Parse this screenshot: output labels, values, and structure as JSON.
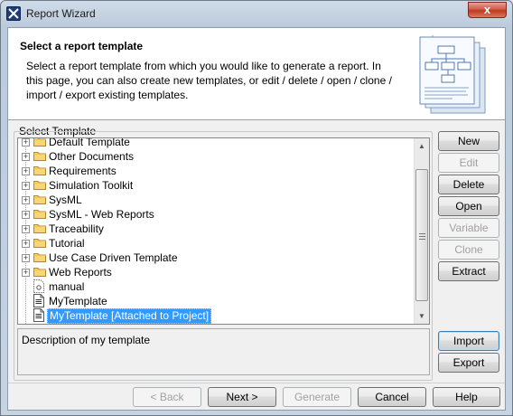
{
  "window": {
    "title": "Report Wizard",
    "close_glyph": "x"
  },
  "header": {
    "title": "Select a report template",
    "description": "Select a report template from which you would like to generate a report. In this page, you can also create new templates, or edit / delete / open / clone / import / export existing templates."
  },
  "templates": {
    "group_label": "Select Template",
    "items": [
      {
        "label": "Default Template",
        "type": "folder"
      },
      {
        "label": "Other Documents",
        "type": "folder"
      },
      {
        "label": "Requirements",
        "type": "folder"
      },
      {
        "label": "Simulation Toolkit",
        "type": "folder"
      },
      {
        "label": "SysML",
        "type": "folder"
      },
      {
        "label": "SysML - Web Reports",
        "type": "folder"
      },
      {
        "label": "Traceability",
        "type": "folder"
      },
      {
        "label": "Tutorial",
        "type": "folder"
      },
      {
        "label": "Use Case Driven Template",
        "type": "folder"
      },
      {
        "label": "Web Reports",
        "type": "folder"
      },
      {
        "label": "manual",
        "type": "file"
      },
      {
        "label": "MyTemplate",
        "type": "file"
      },
      {
        "label": "MyTemplate [Attached to Project]",
        "type": "file",
        "selected": true
      }
    ],
    "description": "Description of my template"
  },
  "side_buttons": {
    "new": "New",
    "edit": "Edit",
    "delete": "Delete",
    "open": "Open",
    "variable": "Variable",
    "clone": "Clone",
    "extract": "Extract",
    "import": "Import",
    "export": "Export"
  },
  "footer_buttons": {
    "back": "< Back",
    "next": "Next >",
    "generate": "Generate",
    "cancel": "Cancel",
    "help": "Help"
  },
  "colors": {
    "selection": "#3399ff",
    "folder": "#f7d774"
  }
}
